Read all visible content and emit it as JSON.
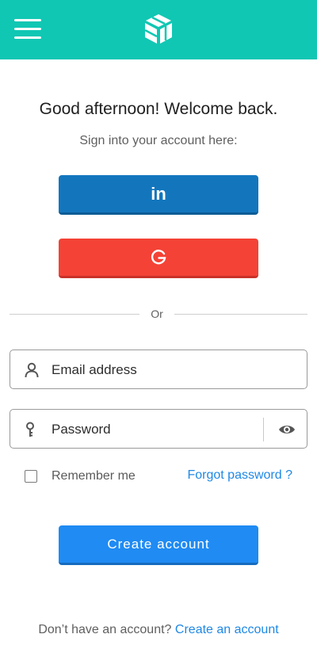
{
  "header": {
    "menu_icon": "hamburger-menu-icon",
    "logo_icon": "cube-logo-icon",
    "background_color": "#10c7b3"
  },
  "login": {
    "greeting": "Good afternoon! Welcome back.",
    "subtitle": "Sign into your account here:",
    "linkedin_label": "in",
    "linkedin_color": "#1376bd",
    "google_icon": "google-g-icon",
    "google_color": "#f44236",
    "divider_text": "Or",
    "email_placeholder": "Email address",
    "password_placeholder": "Password",
    "remember_label": "Remember me",
    "remember_checked": false,
    "forgot_label": "Forgot password ?",
    "create_button_label": "Create account",
    "footer_text": "Don’t have an account?",
    "footer_link": "Create an account"
  }
}
